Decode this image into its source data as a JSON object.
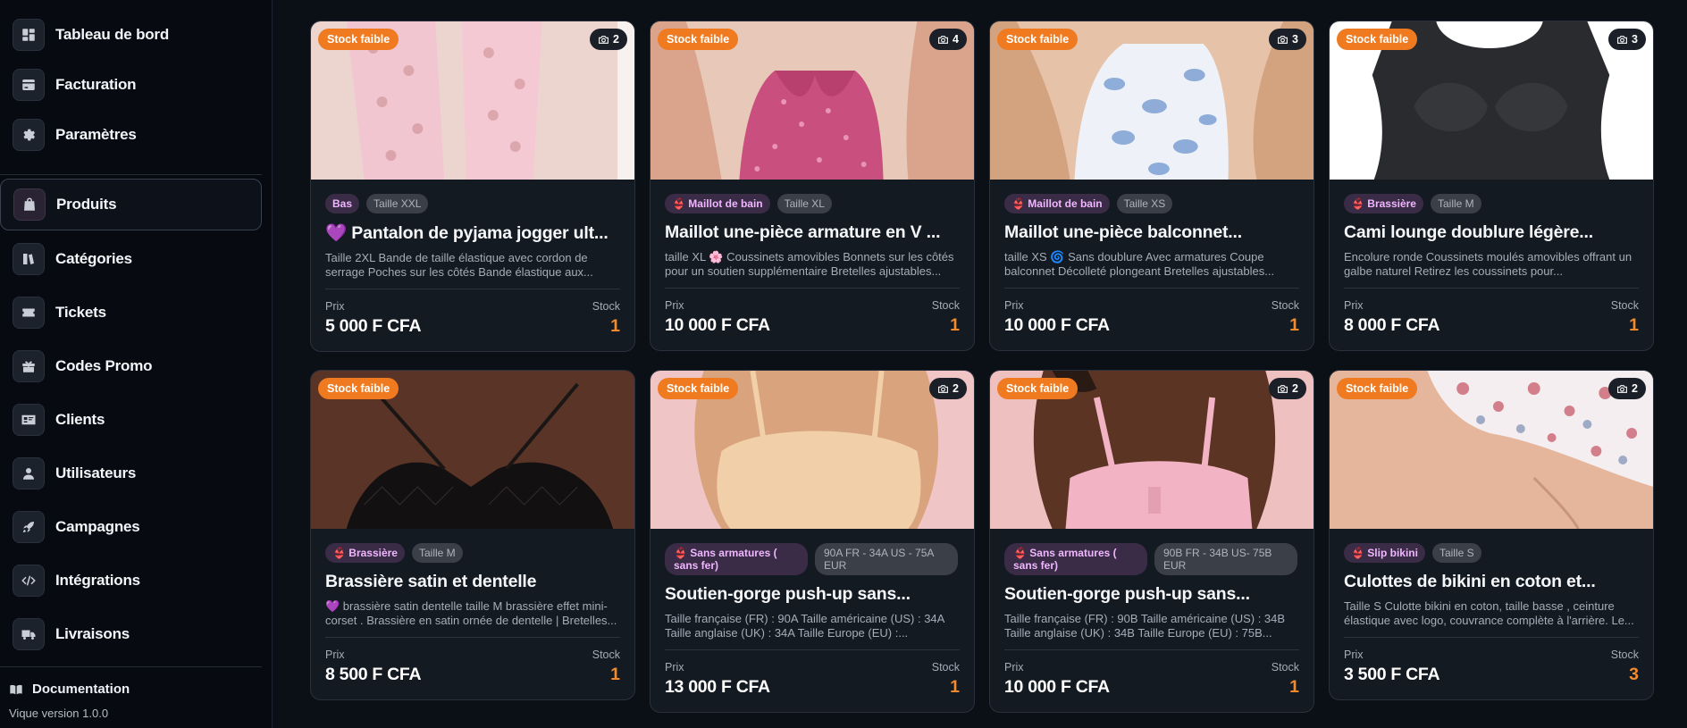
{
  "sidebar": {
    "items": [
      {
        "label": "Tableau de bord",
        "icon": "dashboard-icon"
      },
      {
        "label": "Facturation",
        "icon": "credit-card-icon"
      },
      {
        "label": "Paramètres",
        "icon": "gear-icon"
      },
      {
        "label": "Produits",
        "icon": "shopping-bag-icon",
        "active": true
      },
      {
        "label": "Catégories",
        "icon": "categories-icon"
      },
      {
        "label": "Tickets",
        "icon": "ticket-icon"
      },
      {
        "label": "Codes Promo",
        "icon": "gift-icon"
      },
      {
        "label": "Clients",
        "icon": "id-card-icon"
      },
      {
        "label": "Utilisateurs",
        "icon": "user-icon"
      },
      {
        "label": "Campagnes",
        "icon": "rocket-icon"
      },
      {
        "label": "Intégrations",
        "icon": "code-icon"
      },
      {
        "label": "Livraisons",
        "icon": "truck-icon"
      }
    ],
    "documentation": "Documentation",
    "version": "Vique version 1.0.0"
  },
  "labels": {
    "price": "Prix",
    "stock": "Stock"
  },
  "colors": {
    "accent": "#f07a1f",
    "stock_value": "#f28a2e",
    "category_tag": "#f0b6ff"
  },
  "products": [
    {
      "badge": "Stock faible",
      "photos": "2",
      "category": "Bas",
      "size": "Taille XXL",
      "title": "💜 Pantalon de pyjama jogger ult...",
      "desc": "Taille 2XL Bande de taille élastique avec cordon de serrage Poches sur les côtés Bande élastique aux...",
      "price": "5 000 F CFA",
      "stock": "1"
    },
    {
      "badge": "Stock faible",
      "photos": "4",
      "category": "👙 Maillot de bain",
      "size": "Taille XL",
      "title": "Maillot une-pièce armature en V ...",
      "desc": "taille XL 🌸 Coussinets amovibles Bonnets sur les côtés pour un soutien supplémentaire Bretelles ajustables...",
      "price": "10 000 F CFA",
      "stock": "1"
    },
    {
      "badge": "Stock faible",
      "photos": "3",
      "category": "👙 Maillot de bain",
      "size": "Taille XS",
      "title": "Maillot une-pièce balconnet...",
      "desc": "taille XS 🌀 Sans doublure Avec armatures Coupe balconnet Décolleté plongeant Bretelles ajustables...",
      "price": "10 000 F CFA",
      "stock": "1"
    },
    {
      "badge": "Stock faible",
      "photos": "3",
      "category": "👙 Brassière",
      "size": "Taille M",
      "title": "Cami lounge doublure légère...",
      "desc": "Encolure ronde Coussinets moulés amovibles offrant un galbe naturel Retirez les coussinets pour...",
      "price": "8 000 F CFA",
      "stock": "1"
    },
    {
      "badge": "Stock faible",
      "photos": "",
      "category": "👙 Brassière",
      "size": "Taille M",
      "title": "Brassière satin et dentelle",
      "desc": "💜 brassière satin dentelle taille M brassière effet mini-corset . Brassière en satin ornée de dentelle | Bretelles...",
      "price": "8 500 F CFA",
      "stock": "1"
    },
    {
      "badge": "Stock faible",
      "photos": "2",
      "category": "👙 Sans armatures ( sans fer)",
      "size": "90A FR - 34A US - 75A EUR",
      "title": "Soutien-gorge push-up sans...",
      "desc": "Taille française (FR) : 90A Taille américaine (US) : 34A Taille anglaise (UK) : 34A Taille Europe (EU) :...",
      "price": "13 000 F CFA",
      "stock": "1"
    },
    {
      "badge": "Stock faible",
      "photos": "2",
      "category": "👙 Sans armatures ( sans fer)",
      "size": "90B FR - 34B US- 75B EUR",
      "title": "Soutien-gorge push-up sans...",
      "desc": "Taille française (FR) : 90B Taille américaine (US) : 34B Taille anglaise (UK) : 34B Taille Europe (EU) : 75B...",
      "price": "10 000 F CFA",
      "stock": "1"
    },
    {
      "badge": "Stock faible",
      "photos": "2",
      "category": "👙 Slip bikini",
      "size": "Taille S",
      "title": "Culottes de bikini en coton et...",
      "desc": "Taille S Culotte bikini en coton, taille basse , ceinture élastique avec logo, couvrance complète à l'arrière. Le...",
      "price": "3 500 F CFA",
      "stock": "3"
    }
  ]
}
